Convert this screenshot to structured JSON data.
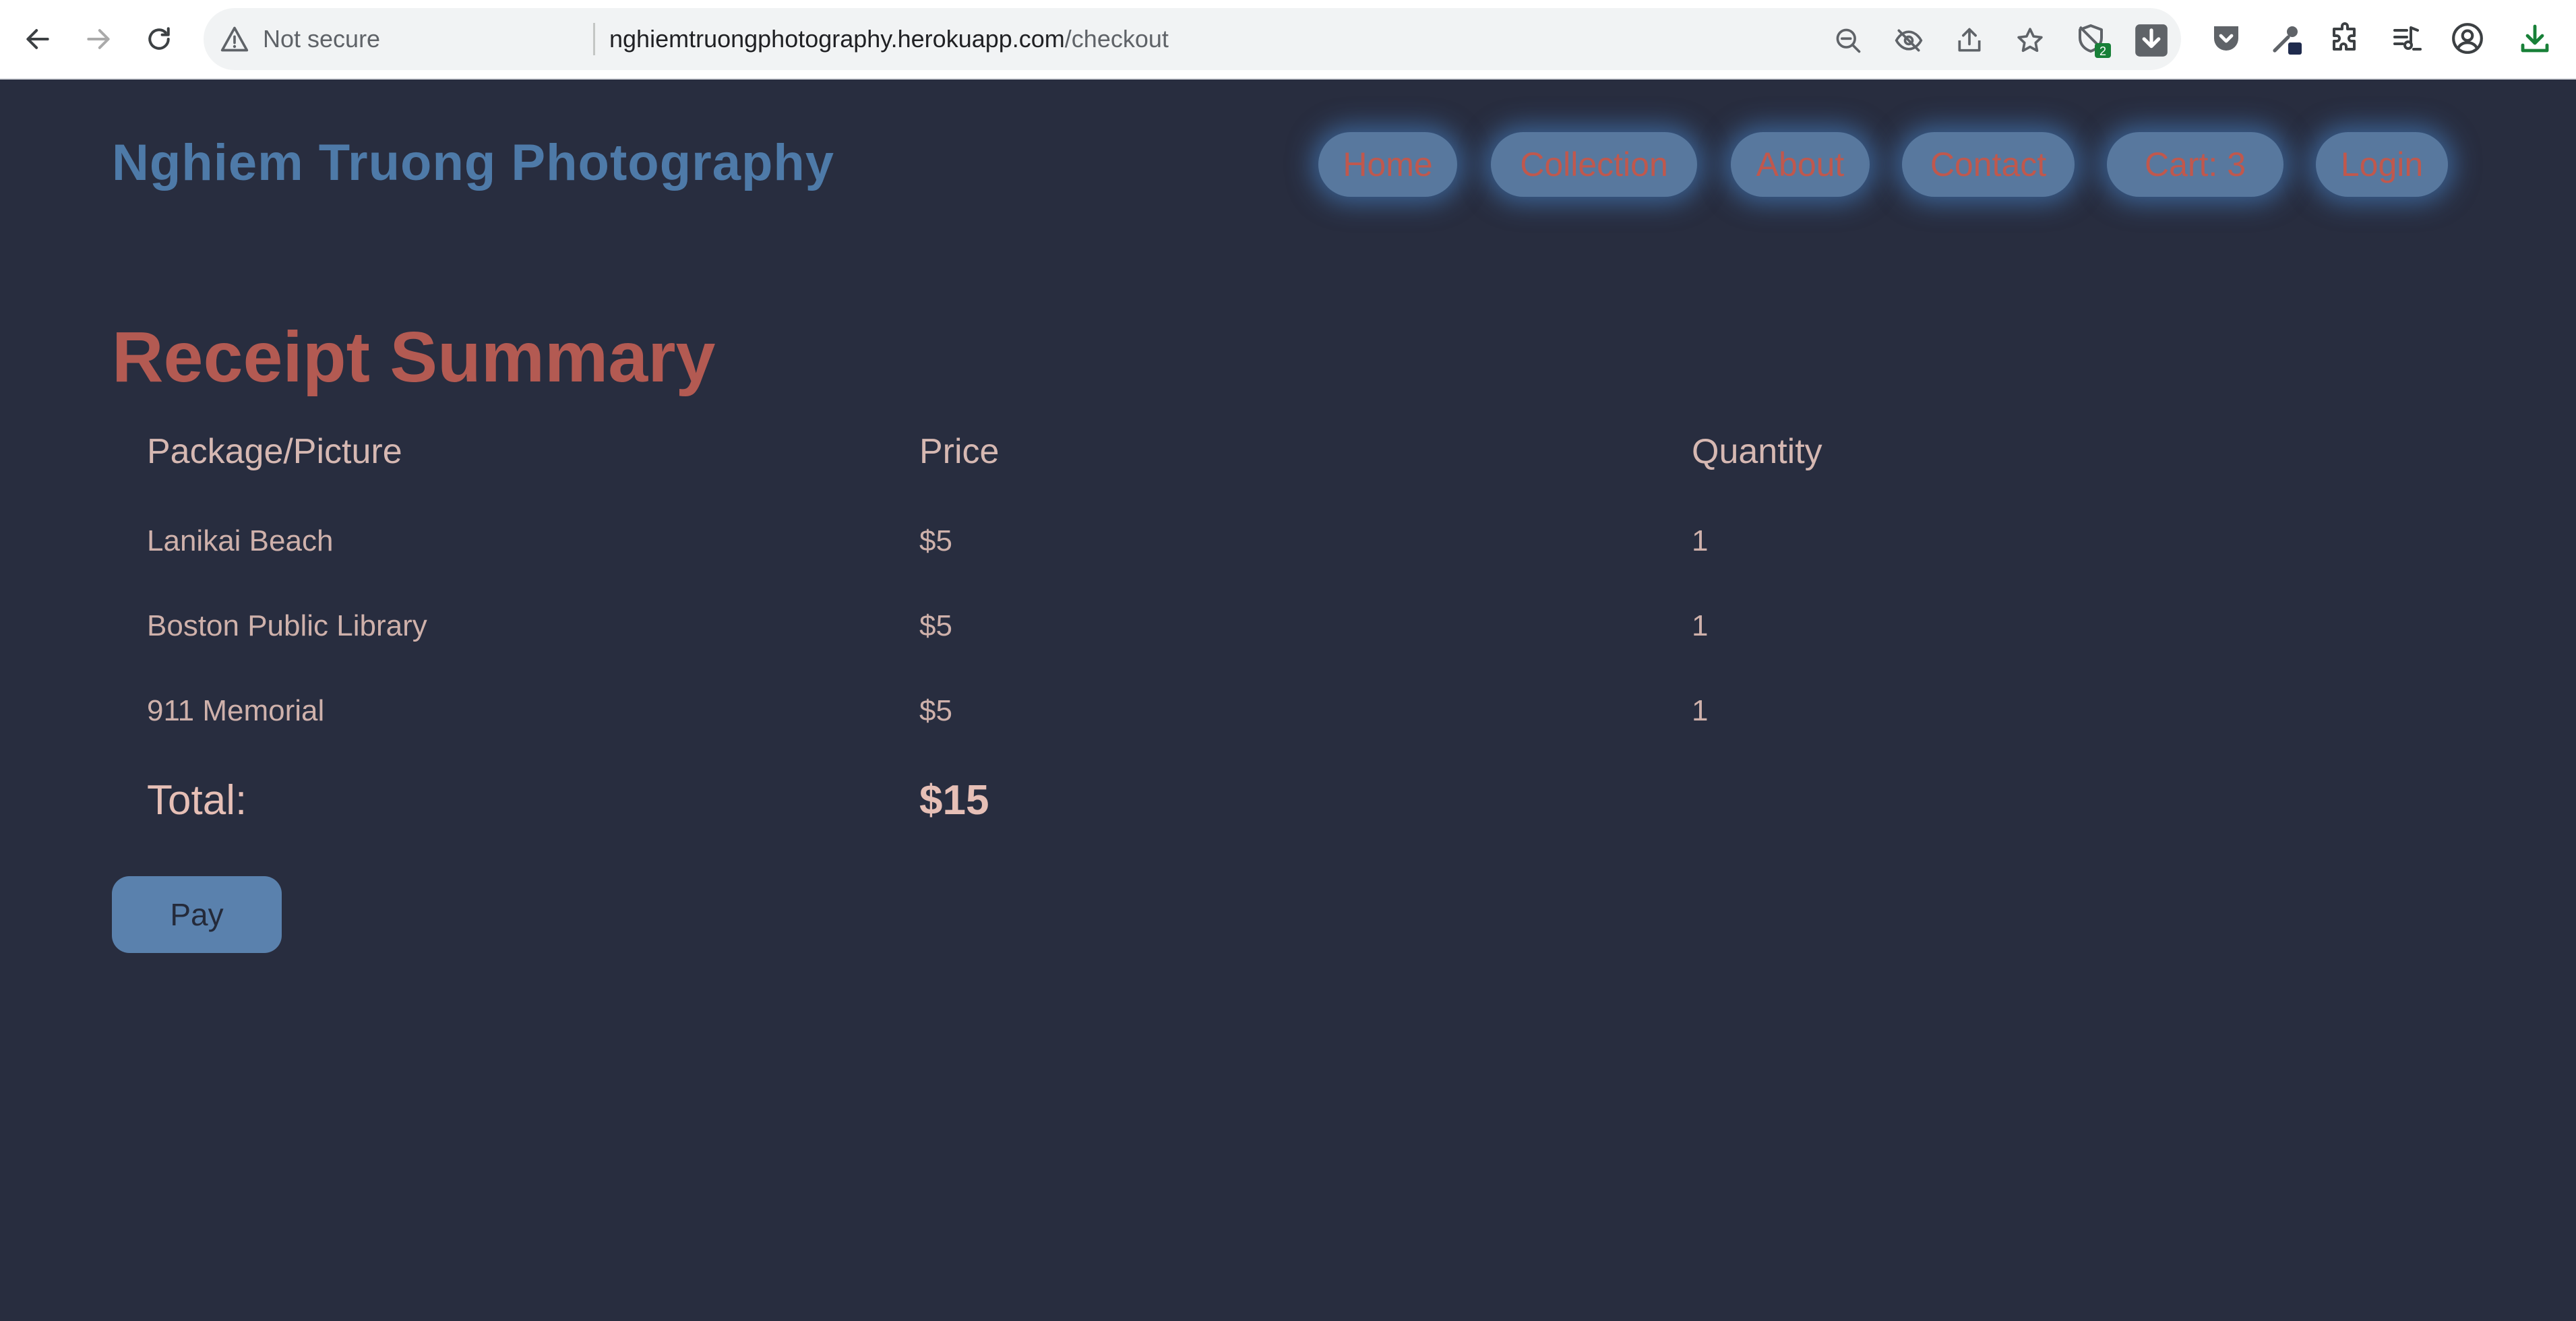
{
  "browser": {
    "security_text": "Not secure",
    "url_host": "nghiemtruongphotography.herokuapp.com",
    "url_path": "/checkout",
    "shield_badge": "2"
  },
  "site": {
    "brand": "Nghiem Truong Photography",
    "nav": [
      {
        "label": "Home"
      },
      {
        "label": "Collection"
      },
      {
        "label": "About"
      },
      {
        "label": "Contact"
      },
      {
        "label": "Cart: 3"
      },
      {
        "label": "Login"
      }
    ]
  },
  "receipt": {
    "title": "Receipt Summary",
    "columns": [
      "Package/Picture",
      "Price",
      "Quantity"
    ],
    "rows": [
      {
        "name": "Lanikai Beach",
        "price": "$5",
        "quantity": "1"
      },
      {
        "name": "Boston Public Library",
        "price": "$5",
        "quantity": "1"
      },
      {
        "name": "911 Memorial",
        "price": "$5",
        "quantity": "1"
      }
    ],
    "total_label": "Total:",
    "total_value": "$15",
    "pay_label": "Pay"
  },
  "colors": {
    "page_background": "#282d3f",
    "brand_blue": "#4e7aa8",
    "title_red": "#b35a52",
    "nav_pill": "#58789e",
    "nav_text": "#c0584d",
    "pay_button": "#5a81ad"
  }
}
